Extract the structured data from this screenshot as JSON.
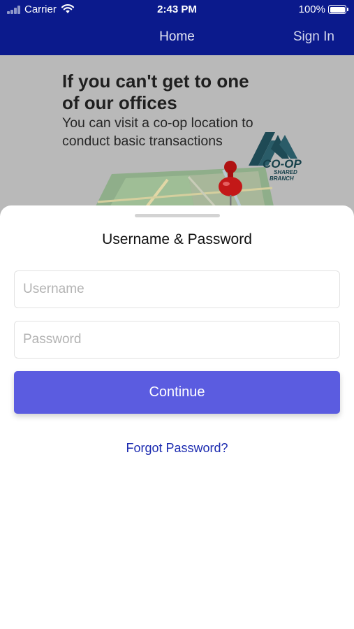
{
  "status_bar": {
    "carrier": "Carrier",
    "time": "2:43 PM",
    "battery": "100%",
    "icons": [
      "signal-icon",
      "wifi-icon",
      "battery-icon"
    ]
  },
  "nav": {
    "title": "Home",
    "sign_in": "Sign In"
  },
  "banner": {
    "heading_line1": "If you can't get to one",
    "heading_line2": "of our offices",
    "subtitle_line1": "You can visit a co-op location to",
    "subtitle_line2": "conduct basic transactions",
    "logo_main": "CO-OP",
    "logo_sub1": "SHARED",
    "logo_sub2": "BRANCH"
  },
  "login_sheet": {
    "title": "Username & Password",
    "username_placeholder": "Username",
    "username_value": "",
    "password_placeholder": "Password",
    "password_value": "",
    "continue_label": "Continue",
    "forgot_label": "Forgot Password?"
  },
  "colors": {
    "header_bg": "#0b1a8c",
    "accent_button": "#5b5ce0",
    "link": "#1c2bb0"
  }
}
